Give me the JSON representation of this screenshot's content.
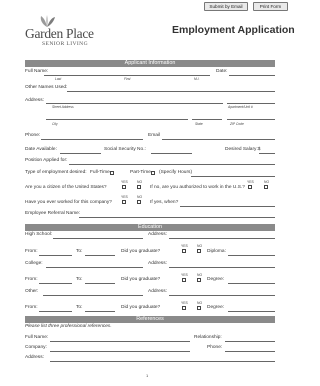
{
  "toolbar": {
    "submit_label": "Submit by Email",
    "print_label": "Print Form"
  },
  "brand": {
    "name": "Garden Place",
    "tagline": "SENIOR LIVING"
  },
  "title": "Employment Application",
  "sections": {
    "applicant": "Applicant Information",
    "education": "Education",
    "references": "References"
  },
  "applicant": {
    "full_name": "Full Name:",
    "last": "Last",
    "first": "First",
    "mi": "M.I.",
    "date": "Date:",
    "other_names": "Other Names Used:",
    "address": "Address:",
    "street": "Street Address",
    "apartment": "Apartment/Unit #",
    "city": "City",
    "state": "State",
    "zip": "ZIP Code",
    "phone": "Phone:",
    "email": "Email",
    "date_available": "Date Available:",
    "ssn": "Social Security No.:",
    "salary": "Desired Salary:$",
    "position": "Position Applied for:",
    "employment_type": "Type of employment desired:",
    "full_time": "Full-Time",
    "part_time": "Part-Time",
    "hours": "(Specify Hours)",
    "yes": "YES",
    "no": "NO",
    "citizen": "Are you a citizen of the United States?",
    "authorized": "If no, are you authorized to work in the U.S.?",
    "worked_before": "Have you ever worked for this company?",
    "when": "If yes, when?",
    "referral": "Employee Referral Name:"
  },
  "education": {
    "high_school": "High School:",
    "address": "Address:",
    "from": "From:",
    "to": "To:",
    "graduate": "Did you graduate?",
    "diploma": "Diploma:",
    "college": "College:",
    "degree": "Degree:",
    "other": "Other:"
  },
  "references": {
    "instruction": "Please list three professional references.",
    "full_name": "Full Name:",
    "relationship": "Relationship:",
    "company": "Company:",
    "phone": "Phone:",
    "address": "Address:"
  },
  "page_number": "1"
}
